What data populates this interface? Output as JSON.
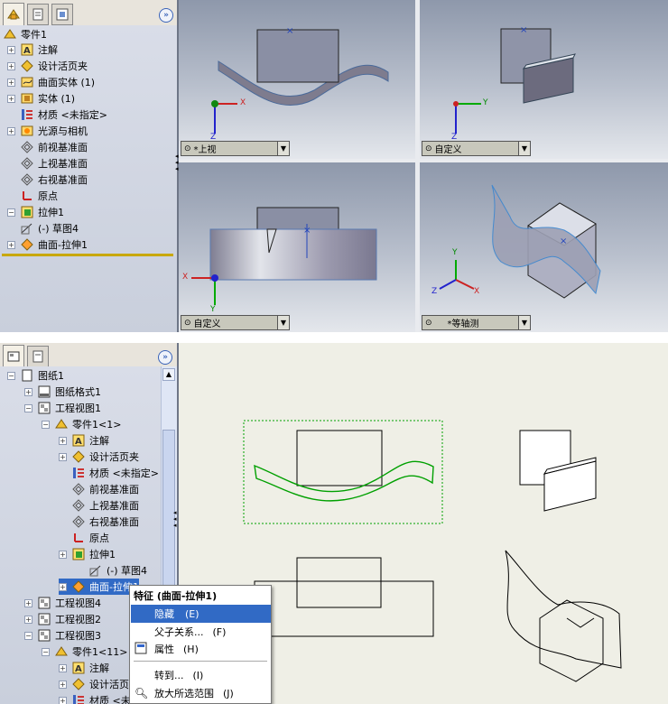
{
  "top_tree": {
    "root": "零件1",
    "items": [
      {
        "label": "注解",
        "expand": "+"
      },
      {
        "label": "设计活页夹",
        "expand": "+"
      },
      {
        "label": "曲面实体 (1)",
        "expand": "+"
      },
      {
        "label": "实体 (1)",
        "expand": "+"
      },
      {
        "label": "材质 <未指定>",
        "expand": ""
      },
      {
        "label": "光源与相机",
        "expand": "+"
      },
      {
        "label": "前视基准面",
        "expand": ""
      },
      {
        "label": "上视基准面",
        "expand": ""
      },
      {
        "label": "右视基准面",
        "expand": ""
      },
      {
        "label": "原点",
        "expand": ""
      },
      {
        "label": "拉伸1",
        "expand": "−"
      },
      {
        "label": "(-) 草图4",
        "expand": ""
      },
      {
        "label": "曲面-拉伸1",
        "expand": "+"
      }
    ]
  },
  "viewports": {
    "top_left": "*上视",
    "top_right": "自定义",
    "bottom_left": "自定义",
    "bottom_right": "*等轴测"
  },
  "axes": {
    "x": "X",
    "y": "Y",
    "z": "Z"
  },
  "bottom_tree": {
    "items": [
      {
        "label": "图纸1",
        "expand": "−"
      },
      {
        "label": "图纸格式1",
        "expand": "+"
      },
      {
        "label": "工程视图1",
        "expand": "−"
      },
      {
        "label": "零件1<1>",
        "expand": "−"
      },
      {
        "label": "注解",
        "expand": "+"
      },
      {
        "label": "设计活页夹",
        "expand": "+"
      },
      {
        "label": "材质 <未指定>",
        "expand": ""
      },
      {
        "label": "前视基准面",
        "expand": ""
      },
      {
        "label": "上视基准面",
        "expand": ""
      },
      {
        "label": "右视基准面",
        "expand": ""
      },
      {
        "label": "原点",
        "expand": ""
      },
      {
        "label": "拉伸1",
        "expand": "+"
      },
      {
        "label": "(-) 草图4",
        "expand": ""
      },
      {
        "label": "曲面-拉伸1",
        "expand": "+"
      },
      {
        "label": "工程视图4",
        "expand": "+"
      },
      {
        "label": "工程视图2",
        "expand": "+"
      },
      {
        "label": "工程视图3",
        "expand": "−"
      },
      {
        "label": "零件1<11>",
        "expand": "−"
      },
      {
        "label": "注解",
        "expand": "+"
      },
      {
        "label": "设计活页夹",
        "expand": "+"
      },
      {
        "label": "材质 <未",
        "expand": "+"
      }
    ]
  },
  "context_menu": {
    "title": "特征 (曲面-拉伸1)",
    "items": [
      {
        "label": "隐藏",
        "key": "E"
      },
      {
        "label": "父子关系...",
        "key": "F"
      },
      {
        "label": "属性",
        "key": "H"
      },
      {
        "label": "转到...",
        "key": "I"
      },
      {
        "label": "放大所选范围",
        "key": "J"
      }
    ]
  },
  "colors": {
    "selection": "#316ac5",
    "drawing_green": "#00a000",
    "sheet_bg": "#efefe6",
    "viewport_blue": "#2255aa"
  }
}
